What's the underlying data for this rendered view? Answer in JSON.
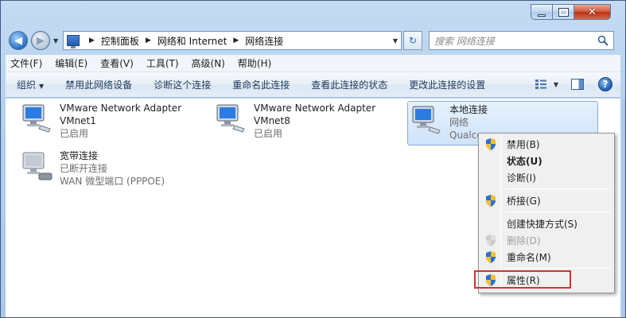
{
  "window": {
    "title": ""
  },
  "nav": {
    "breadcrumbs": [
      "控制面板",
      "网络和 Internet",
      "网络连接"
    ],
    "search_placeholder": "搜索 网络连接"
  },
  "menubar": [
    "文件(F)",
    "编辑(E)",
    "查看(V)",
    "工具(T)",
    "高级(N)",
    "帮助(H)"
  ],
  "commandbar": {
    "organize": "组织",
    "items": [
      "禁用此网络设备",
      "诊断这个连接",
      "重命名此连接",
      "查看此连接的状态",
      "更改此连接的设置"
    ]
  },
  "connections": [
    {
      "name": "VMware Network Adapter",
      "line2": "VMnet1",
      "line3": "已启用"
    },
    {
      "name": "VMware Network Adapter",
      "line2": "VMnet8",
      "line3": "已启用"
    },
    {
      "name": "本地连接",
      "line2": "网络",
      "line3": "Qualco"
    },
    {
      "name": "宽带连接",
      "line2": "已断开连接",
      "line3": "WAN 微型端口 (PPPOE)"
    }
  ],
  "context_menu": [
    {
      "label": "禁用(B)",
      "shield": true,
      "bold": false,
      "disabled": false
    },
    {
      "label": "状态(U)",
      "shield": false,
      "bold": true,
      "disabled": false
    },
    {
      "label": "诊断(I)",
      "shield": false,
      "bold": false,
      "disabled": false
    },
    {
      "label": "桥接(G)",
      "shield": true,
      "bold": false,
      "disabled": false
    },
    {
      "label": "创建快捷方式(S)",
      "shield": false,
      "bold": false,
      "disabled": false
    },
    {
      "label": "删除(D)",
      "shield": true,
      "bold": false,
      "disabled": true
    },
    {
      "label": "重命名(M)",
      "shield": true,
      "bold": false,
      "disabled": false
    },
    {
      "label": "属性(R)",
      "shield": true,
      "bold": false,
      "disabled": false
    }
  ],
  "colors": {
    "highlight_box": "#d23232",
    "selection": "#cfe3fa"
  }
}
